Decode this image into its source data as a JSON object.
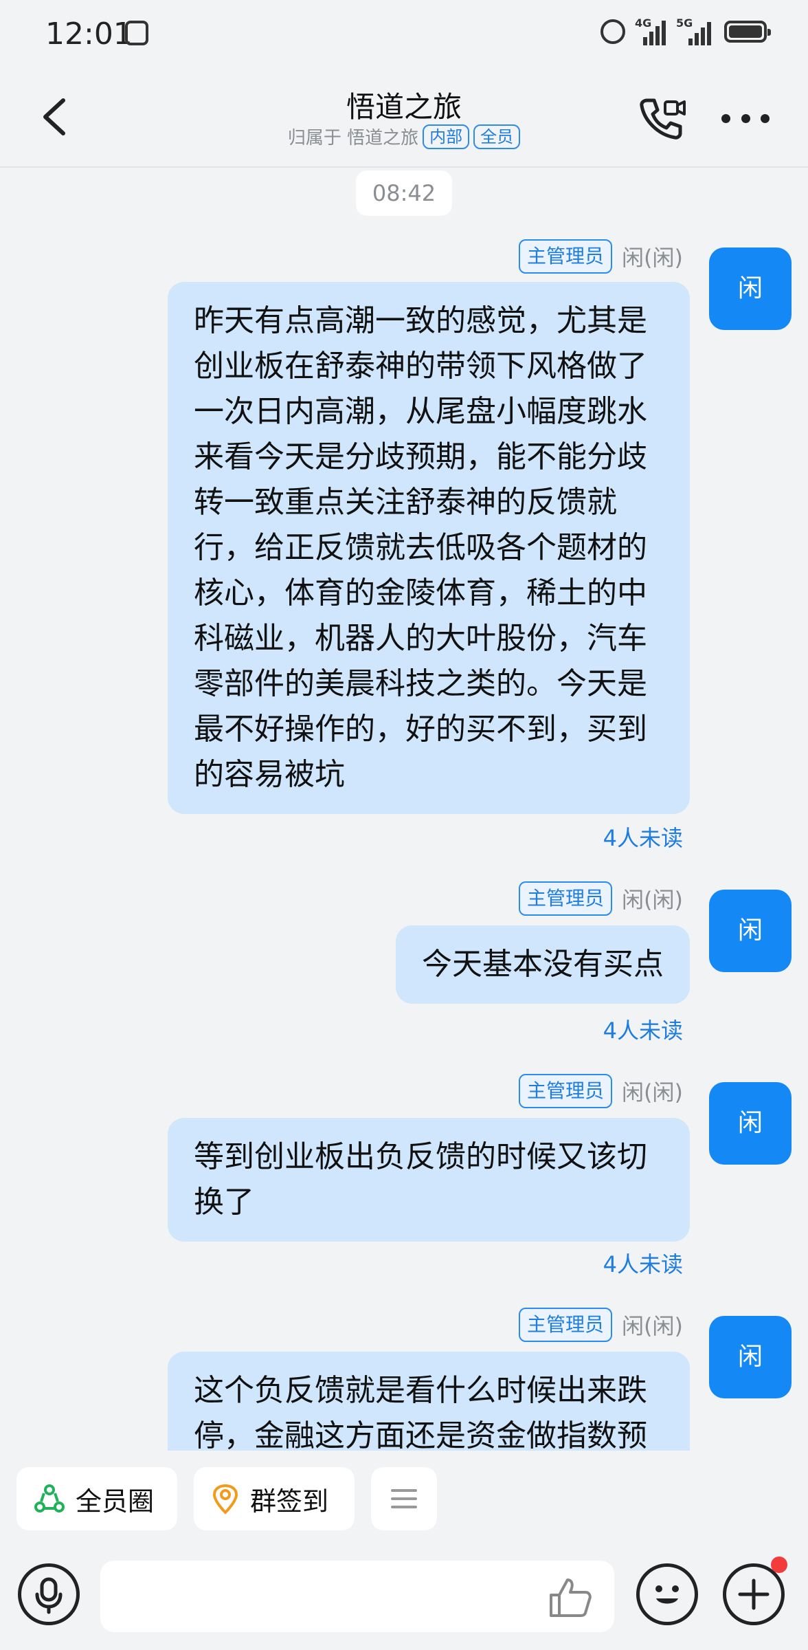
{
  "status_bar": {
    "time": "12:01",
    "net1": "4G",
    "net2": "5G"
  },
  "header": {
    "title": "悟道之旅",
    "subtitle_prefix": "归属于 悟道之旅",
    "tag_internal": "内部",
    "tag_all": "全员"
  },
  "chat": {
    "timestamp": "08:42",
    "messages": [
      {
        "role": "主管理员",
        "sender": "闲(闲)",
        "avatar": "闲",
        "text": "昨天有点高潮一致的感觉，尤其是创业板在舒泰神的带领下风格做了一次日内高潮，从尾盘小幅度跳水来看今天是分歧预期，能不能分歧转一致重点关注舒泰神的反馈就行，给正反馈就去低吸各个题材的核心，体育的金陵体育，稀土的中科磁业，机器人的大叶股份，汽车零部件的美晨科技之类的。今天是最不好操作的，好的买不到，买到的容易被坑",
        "unread": "4人未读"
      },
      {
        "role": "主管理员",
        "sender": "闲(闲)",
        "avatar": "闲",
        "text": "今天基本没有买点",
        "unread": "4人未读"
      },
      {
        "role": "主管理员",
        "sender": "闲(闲)",
        "avatar": "闲",
        "text": "等到创业板出负反馈的时候又该切换了",
        "unread": "4人未读"
      },
      {
        "role": "主管理员",
        "sender": "闲(闲)",
        "avatar": "闲",
        "text": "这个负反馈就是看什么时候出来跌停，金融这方面还是资金做指数预"
      }
    ]
  },
  "quick_actions": {
    "all_circle": "全员圈",
    "group_checkin": "群签到"
  },
  "icons": {
    "back": "chevron-left-icon",
    "call": "video-call-icon",
    "more": "more-icon",
    "mic": "microphone-icon",
    "like": "thumbs-up-icon",
    "emoji": "emoji-icon",
    "plus": "plus-icon"
  },
  "colors": {
    "accent": "#1488f5",
    "bubble": "#cfe6fd",
    "badge": "#f23c3c"
  }
}
